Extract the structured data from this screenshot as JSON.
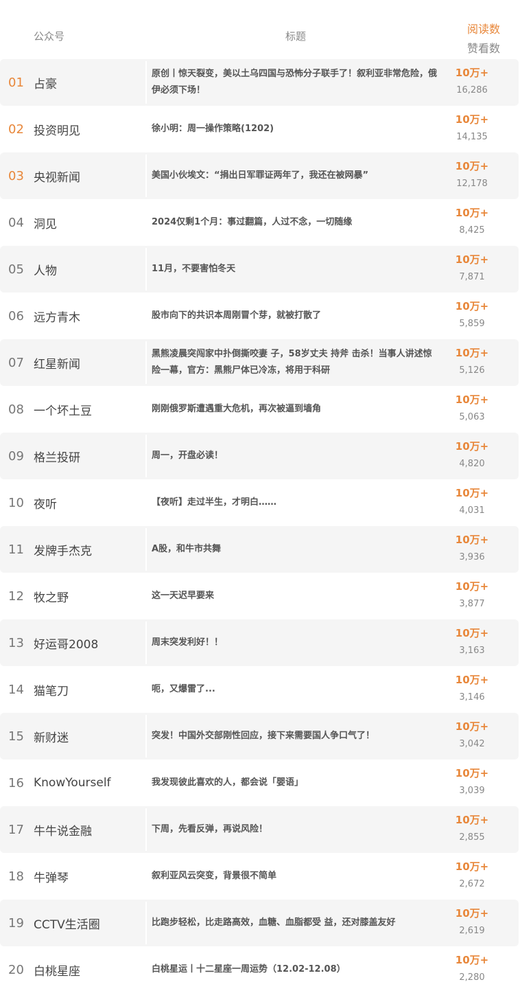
{
  "header": {
    "account_label": "公众号",
    "title_label": "标题",
    "reads_label": "阅读数",
    "likes_label": "赞看数"
  },
  "rows": [
    {
      "rank": "01",
      "account": "占豪",
      "title": "原创丨惊天裂变，美以土乌四国与恐怖分子联手了！叙利亚非常危险，俄伊必须下场！",
      "reads": "10万+",
      "likes": "16,286"
    },
    {
      "rank": "02",
      "account": "投资明见",
      "title": "徐小明：周一操作策略(1202)",
      "reads": "10万+",
      "likes": "14,135"
    },
    {
      "rank": "03",
      "account": "央视新闻",
      "title": "美国小伙埃文：“捐出日军罪证两年了，我还在被网暴”",
      "reads": "10万+",
      "likes": "12,178"
    },
    {
      "rank": "04",
      "account": "洞见",
      "title": "2024仅剩1个月：事过翻篇，人过不念，一切随缘",
      "reads": "10万+",
      "likes": "8,425"
    },
    {
      "rank": "05",
      "account": "人物",
      "title": "11月，不要害怕冬天",
      "reads": "10万+",
      "likes": "7,871"
    },
    {
      "rank": "06",
      "account": "远方青木",
      "title": "股市向下的共识本周刚冒个芽，就被打散了",
      "reads": "10万+",
      "likes": "5,859"
    },
    {
      "rank": "07",
      "account": "红星新闻",
      "title": "黑熊凌晨突闯家中扑倒撕咬妻 子，58岁丈夫 持斧 击杀！当事人讲述惊险一幕，官方：黑熊尸体已冷冻，将用于科研",
      "reads": "10万+",
      "likes": "5,126"
    },
    {
      "rank": "08",
      "account": "一个坏土豆",
      "title": "刚刚俄罗斯遭遇重大危机，再次被逼到墙角",
      "reads": "10万+",
      "likes": "5,063"
    },
    {
      "rank": "09",
      "account": "格兰投研",
      "title": "周一，开盘必读！",
      "reads": "10万+",
      "likes": "4,820"
    },
    {
      "rank": "10",
      "account": "夜听",
      "title": "【夜听】走过半生，才明白……",
      "reads": "10万+",
      "likes": "4,031"
    },
    {
      "rank": "11",
      "account": "发牌手杰克",
      "title": "A股，和牛市共舞",
      "reads": "10万+",
      "likes": "3,936"
    },
    {
      "rank": "12",
      "account": "牧之野",
      "title": "这一天迟早要来",
      "reads": "10万+",
      "likes": "3,877"
    },
    {
      "rank": "13",
      "account": "好运哥2008",
      "title": "周末突发利好！！",
      "reads": "10万+",
      "likes": "3,163"
    },
    {
      "rank": "14",
      "account": "猫笔刀",
      "title": "呃，又爆雷了...",
      "reads": "10万+",
      "likes": "3,146"
    },
    {
      "rank": "15",
      "account": "新财迷",
      "title": "突发！中国外交部刚性回应，接下来需要国人争口气了！",
      "reads": "10万+",
      "likes": "3,042"
    },
    {
      "rank": "16",
      "account": "KnowYourself",
      "title": "我发现彼此喜欢的人，都会说「婴语」",
      "reads": "10万+",
      "likes": "3,039"
    },
    {
      "rank": "17",
      "account": "牛牛说金融",
      "title": "下周，先看反弹，再说风险！",
      "reads": "10万+",
      "likes": "2,855"
    },
    {
      "rank": "18",
      "account": "牛弹琴",
      "title": "叙利亚风云突变，背景很不简单",
      "reads": "10万+",
      "likes": "2,672"
    },
    {
      "rank": "19",
      "account": "CCTV生活圈",
      "title": "比跑步轻松，比走路高效，血糖、血脂都受 益，还对膝盖友好",
      "reads": "10万+",
      "likes": "2,619"
    },
    {
      "rank": "20",
      "account": "白桃星座",
      "title": "白桃星运丨十二星座一周运势（12.02-12.08）",
      "reads": "10万+",
      "likes": "2,280"
    }
  ],
  "colors": {
    "accent": "#e8873a",
    "row_shade": "#f5f5f5",
    "muted_text": "#888888"
  }
}
